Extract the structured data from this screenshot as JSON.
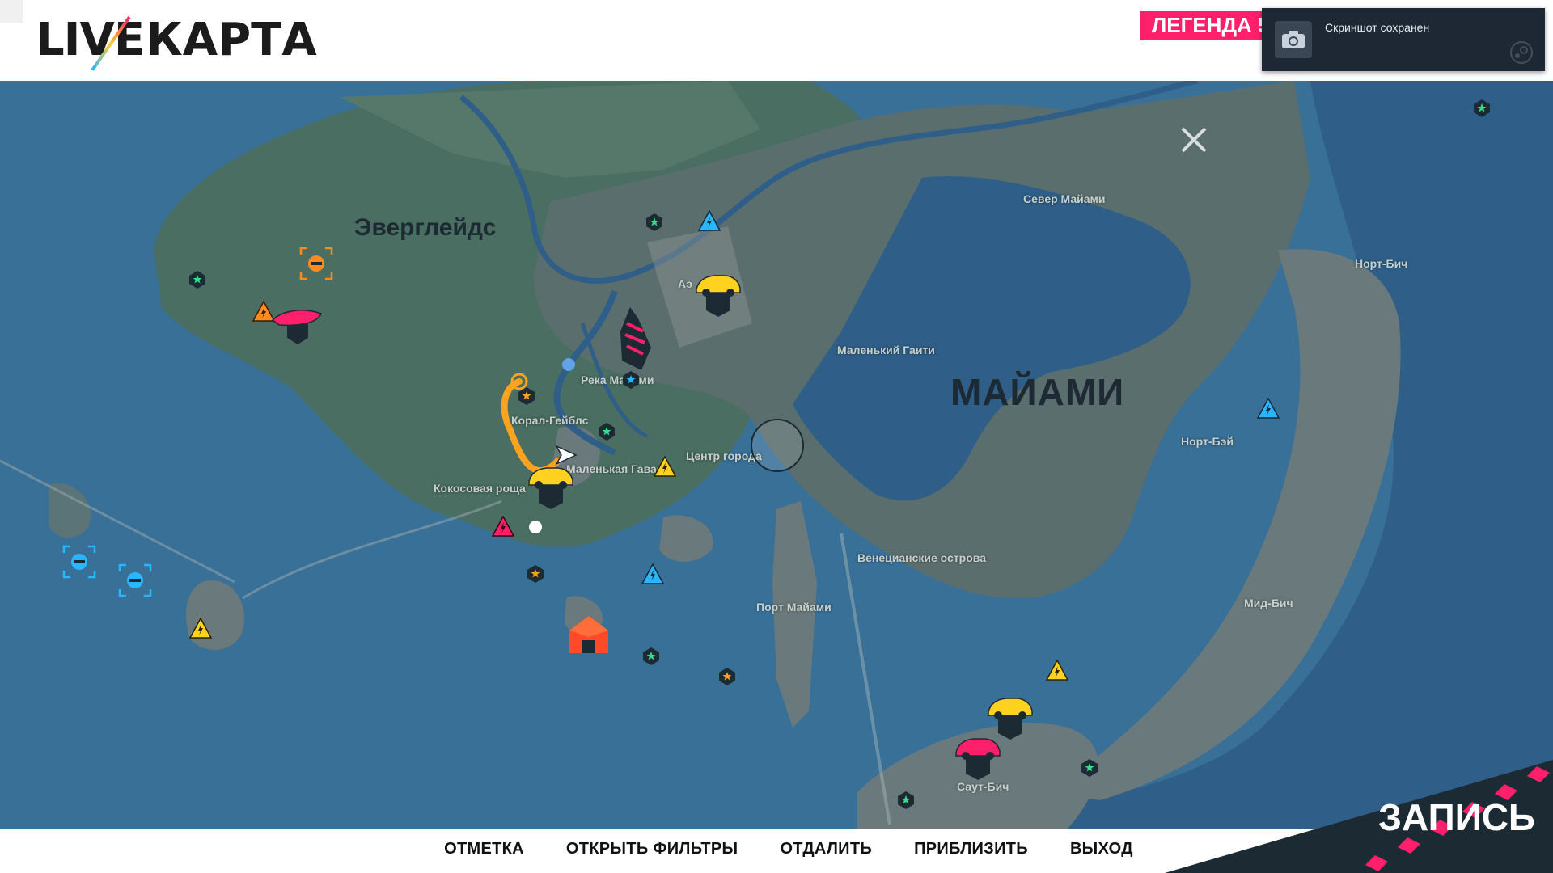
{
  "header": {
    "fps_counter": "",
    "logo_left": "LIVE",
    "logo_right": "КАРТА",
    "legend_badge": "ЛЕГЕНДА 56"
  },
  "toast": {
    "message": "Скриншот сохранен"
  },
  "map": {
    "regions": {
      "everglades": "Эверглейдс",
      "miami": "МАЙАМИ"
    },
    "districts": {
      "north_miami": "Север Майами",
      "north_beach": "Норт-Бич",
      "little_haiti": "Маленький Гаити",
      "miami_river": "Река Майами",
      "coral_gables": "Корал-Гейблс",
      "little_havana": "Маленькая Гавана",
      "downtown": "Центр города",
      "coconut_grove": "Кокосовая роща",
      "north_bay": "Норт-Бэй",
      "venetian_islands": "Венецианские острова",
      "port_miami": "Порт Майами",
      "mid_beach": "Мид-Бич",
      "south_beach": "Саут-Бич",
      "airport": "Аэ"
    }
  },
  "footer": {
    "actions": [
      "ОТМЕТКА",
      "ОТКРЫТЬ ФИЛЬТРЫ",
      "ОТДАЛИТЬ",
      "ПРИБЛИЗИТЬ",
      "ВЫХОД"
    ],
    "record_label": "ЗАПИСЬ"
  },
  "colors": {
    "accent_pink": "#ff1f6b",
    "race_yellow": "#ffd21f",
    "skill_cyan": "#2ab6ff",
    "route_orange": "#ffa21f",
    "water": "#2e5d86",
    "header_bg": "#ffffff"
  }
}
